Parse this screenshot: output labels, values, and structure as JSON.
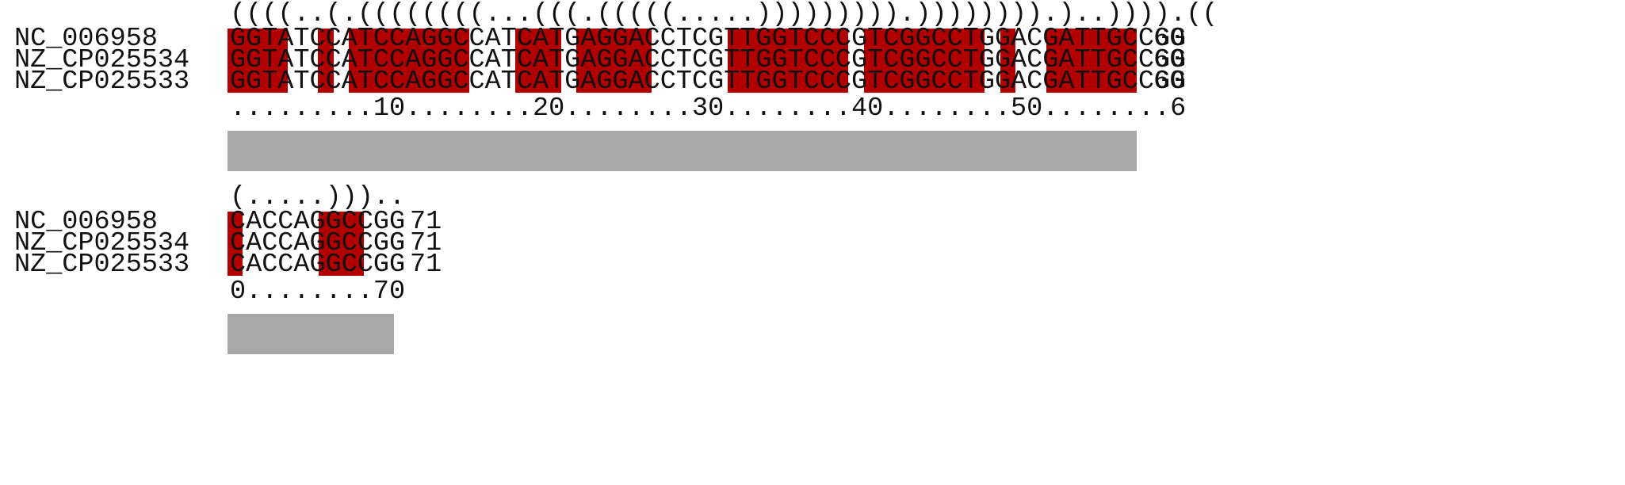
{
  "colors": {
    "paired_highlight": "#b20000",
    "conservation_bar": "#a8a8a8",
    "text": "#111111",
    "background": "#ffffff"
  },
  "blocks": [
    {
      "structure": "((((..(.((((((((...(((.(((((.....))))))))).)))))))).)..)))).((",
      "sequences": [
        {
          "name": "NC_006958",
          "seq": "GGTATCCATCCAGGCCATCATGAGGACCTCGTTGGTCCCGTCGGCCTGGACGATTGCCGG",
          "end": "60"
        },
        {
          "name": "NZ_CP025534",
          "seq": "GGTATCCATCCAGGCCATCATGAGGACCTCGTTGGTCCCGTCGGCCTGGACGATTGCCGG",
          "end": "60"
        },
        {
          "name": "NZ_CP025533",
          "seq": "GGTATCCATCCAGGCCATCATGAGGACCTCGTTGGTCCCGTCGGCCTGGACGATTGCCGG",
          "end": "60"
        }
      ],
      "ruler": ".........10........20........30........40........50........6",
      "conservation": 1.0
    },
    {
      "structure": "(.....)))..",
      "sequences": [
        {
          "name": "NC_006958",
          "seq": "CACCAGGCCGG",
          "end": "71"
        },
        {
          "name": "NZ_CP025534",
          "seq": "CACCAGGCCGG",
          "end": "71"
        },
        {
          "name": "NZ_CP025533",
          "seq": "CACCAGGCCGG",
          "end": "71"
        }
      ],
      "ruler": "0........70",
      "conservation": 1.0
    }
  ]
}
